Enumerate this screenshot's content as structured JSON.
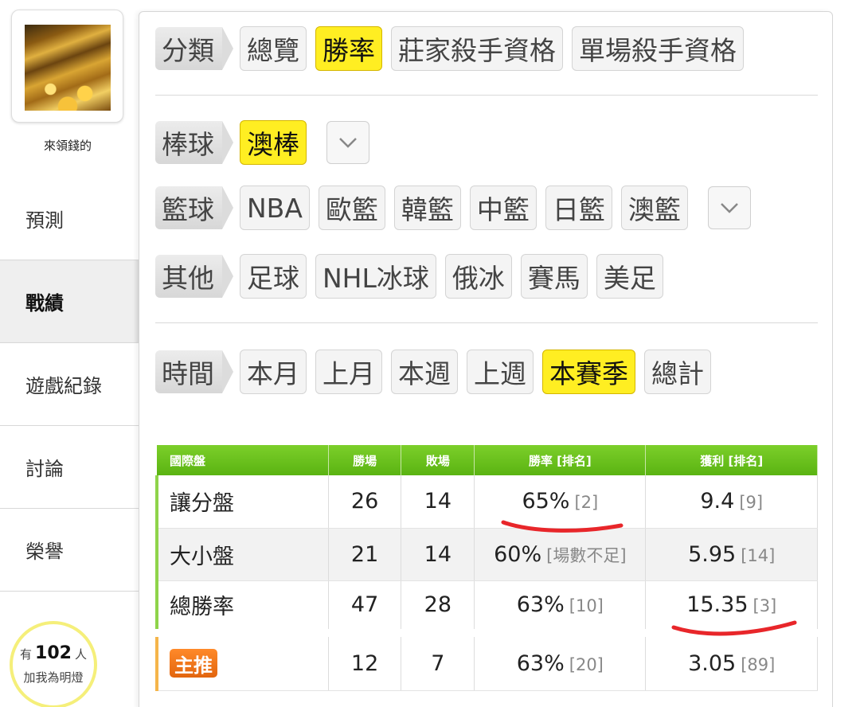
{
  "user": {
    "name": "來領錢的"
  },
  "nav": {
    "items": [
      {
        "label": "預測"
      },
      {
        "label": "戰績"
      },
      {
        "label": "遊戲紀錄"
      },
      {
        "label": "討論"
      },
      {
        "label": "榮譽"
      }
    ],
    "active": "戰績"
  },
  "fans": {
    "prefix": "有",
    "count": "102",
    "suffix": "人",
    "cta": "加我為明燈"
  },
  "filters": {
    "category": {
      "label": "分類",
      "options": [
        "總覽",
        "勝率",
        "莊家殺手資格",
        "單場殺手資格"
      ],
      "selected": "勝率"
    },
    "baseball": {
      "label": "棒球",
      "options": [
        "澳棒"
      ],
      "selected": "澳棒"
    },
    "basketball": {
      "label": "籃球",
      "options": [
        "NBA",
        "歐籃",
        "韓籃",
        "中籃",
        "日籃",
        "澳籃"
      ]
    },
    "other": {
      "label": "其他",
      "options": [
        "足球",
        "NHL冰球",
        "俄冰",
        "賽馬",
        "美足"
      ]
    },
    "time": {
      "label": "時間",
      "options": [
        "本月",
        "上月",
        "本週",
        "上週",
        "本賽季",
        "總計"
      ],
      "selected": "本賽季"
    }
  },
  "table": {
    "headers": [
      "國際盤",
      "勝場",
      "敗場",
      "勝率 [排名]",
      "獲利 [排名]"
    ],
    "rows": [
      {
        "name": "讓分盤",
        "wins": "26",
        "losses": "14",
        "rate": "65%",
        "rate_rank": "[2]",
        "profit": "9.4",
        "profit_rank": "[9]"
      },
      {
        "name": "大小盤",
        "wins": "21",
        "losses": "14",
        "rate": "60%",
        "rate_rank": "[場數不足]",
        "profit": "5.95",
        "profit_rank": "[14]"
      },
      {
        "name": "總勝率",
        "wins": "47",
        "losses": "28",
        "rate": "63%",
        "rate_rank": "[10]",
        "profit": "15.35",
        "profit_rank": "[3]"
      },
      {
        "name": "主推",
        "wins": "12",
        "losses": "7",
        "rate": "63%",
        "rate_rank": "[20]",
        "profit": "3.05",
        "profit_rank": "[89]"
      }
    ]
  },
  "colors": {
    "selected_chip": "#ffee22",
    "table_header": "#5ab312",
    "badge": "#e2650e",
    "annotation": "#e8262a"
  }
}
